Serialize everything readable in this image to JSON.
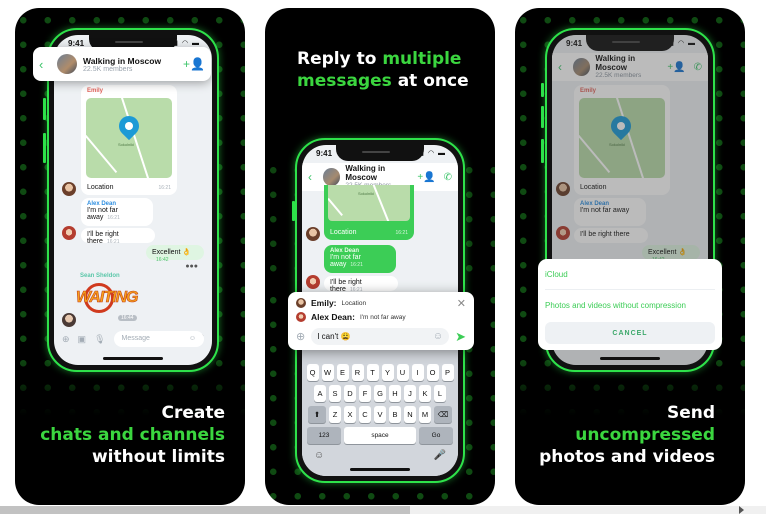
{
  "colors": {
    "accent_green": "#3bd63f",
    "ui_green": "#3ccd56",
    "card_bg": "#000000",
    "pin_blue": "#1c9ad6"
  },
  "chat": {
    "status_time": "9:41",
    "status_icons": "signal wifi battery",
    "title": "Walking in Moscow",
    "members": "22.5K members",
    "back_icon": "‹",
    "add_member_icon": "+👤",
    "call_icon": "✆",
    "map_sender": "Emily",
    "map_label": "Sokolniki",
    "location_text": "Location",
    "location_time": "16:21",
    "alex_name": "Alex Dean",
    "msg1": "I'm not far away",
    "msg1_time": "16:21",
    "msg2": "I'll be right there",
    "msg2_time": "16:21",
    "excellent": "Excellent 👌",
    "excellent_time": "16:42",
    "sean_name": "Sean Sheldon",
    "sticker_text": "WAITING",
    "sticker_time": "16:44",
    "message_placeholder": "Message"
  },
  "panel1": {
    "line1": "Create",
    "line2": "chats and channels",
    "line3": "without limits"
  },
  "panel2": {
    "heading_white1": "Reply to ",
    "heading_green1": "multiple",
    "heading_green2": "messages",
    "heading_white2": " at once",
    "reply_items": [
      {
        "name": "Emily:",
        "text": "Location"
      },
      {
        "name": "Alex Dean:",
        "text": "I'm not far away"
      }
    ],
    "close_icon": "✕",
    "input_value": "I can't 😩",
    "send_icon": "➤",
    "keyboard": {
      "row1": [
        "Q",
        "W",
        "E",
        "R",
        "T",
        "Y",
        "U",
        "I",
        "O",
        "P"
      ],
      "row2": [
        "A",
        "S",
        "D",
        "F",
        "G",
        "H",
        "J",
        "K",
        "L"
      ],
      "row3": [
        "Z",
        "X",
        "C",
        "V",
        "B",
        "N",
        "M"
      ],
      "shift_icon": "⬆",
      "backspace_icon": "⌫",
      "num_label": "123",
      "space_label": "space",
      "go_label": "Go",
      "emoji_icon": "☺",
      "mic_icon": "🎤"
    }
  },
  "panel3": {
    "line1": "Send",
    "line2": "uncompressed",
    "line3": "photos and videos",
    "sheet_option1": "iCloud",
    "sheet_option2": "Photos and videos without compression",
    "sheet_cancel": "CANCEL"
  }
}
